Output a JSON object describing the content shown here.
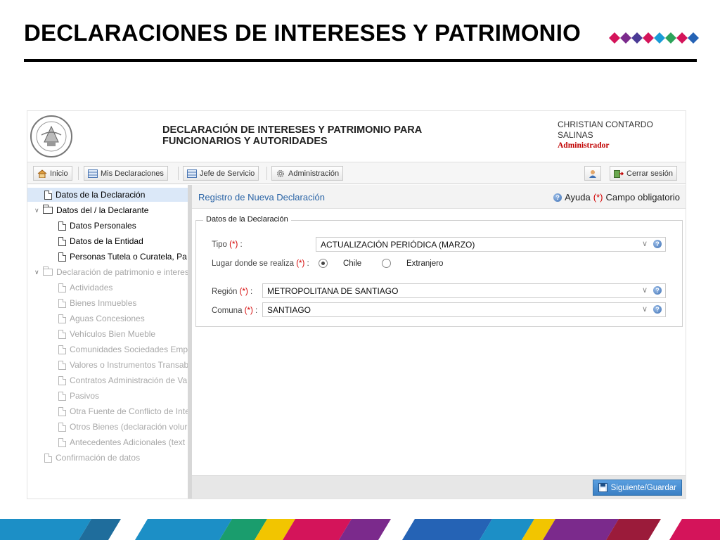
{
  "slide": {
    "title": "DECLARACIONES DE INTERESES Y PATRIMONIO",
    "diamond_colors": [
      "#d4145a",
      "#7b2a8c",
      "#4a3a95",
      "#d4145a",
      "#1a9bd7",
      "#2ca35a",
      "#d4145a",
      "#2563b5"
    ]
  },
  "app": {
    "title_line1": "DECLARACIÓN DE INTERESES Y PATRIMONIO PARA",
    "title_line2": "FUNCIONARIOS Y AUTORIDADES",
    "user_line1": "CHRISTIAN CONTARDO",
    "user_line2": "SALINAS",
    "user_role": "Administrador"
  },
  "toolbar": {
    "inicio": "Inicio",
    "mis_declaraciones": "Mis Declaraciones",
    "jefe_servicio": "Jefe de Servicio",
    "administracion": "Administración",
    "cerrar_sesion": "Cerrar sesión"
  },
  "tree": {
    "items": [
      {
        "label": "Datos de la Declaración"
      },
      {
        "label": "Datos del / la Declarante"
      },
      {
        "label": "Datos Personales"
      },
      {
        "label": "Datos de la Entidad"
      },
      {
        "label": "Personas Tutela o Curatela, Pa"
      },
      {
        "label": "Declaración de patrimonio e interes"
      },
      {
        "label": "Actividades"
      },
      {
        "label": "Bienes Inmuebles"
      },
      {
        "label": "Aguas Concesiones"
      },
      {
        "label": "Vehículos Bien Mueble"
      },
      {
        "label": "Comunidades Sociedades Emp"
      },
      {
        "label": "Valores o Instrumentos Transab"
      },
      {
        "label": "Contratos Administración de Va"
      },
      {
        "label": "Pasivos"
      },
      {
        "label": "Otra Fuente de Conflicto de Inte"
      },
      {
        "label": "Otros Bienes (declaración volur"
      },
      {
        "label": "Antecedentes Adicionales (text"
      },
      {
        "label": "Confirmación de datos"
      }
    ]
  },
  "main": {
    "title": "Registro de Nueva Declaración",
    "help": "Ayuda",
    "required_mark": "(*)",
    "required_text": "Campo obligatorio",
    "fieldset_legend": "Datos de la Declaración",
    "tipo_label": "Tipo",
    "tipo_value": "ACTUALIZACIÓN PERIÓDICA (MARZO)",
    "lugar_label": "Lugar donde se realiza",
    "radio_chile": "Chile",
    "radio_extranjero": "Extranjero",
    "region_label": "Región",
    "region_value": "METROPOLITANA DE SANTIAGO",
    "comuna_label": "Comuna",
    "comuna_value": "SANTIAGO",
    "label_suffix": ":",
    "submit": "Siguiente/Guardar"
  }
}
